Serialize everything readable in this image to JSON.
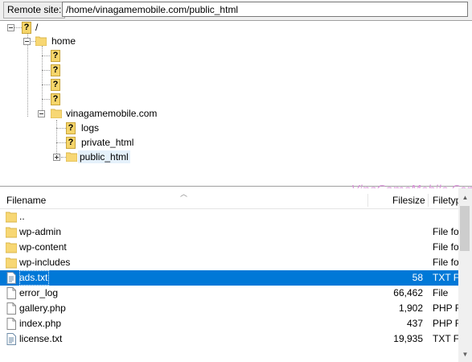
{
  "site_bar": {
    "label": "Remote site:",
    "path": "/home/vinagamemobile.com/public_html"
  },
  "tree": {
    "root": "/",
    "home": "home",
    "unknown_1": "?",
    "unknown_2": "?",
    "unknown_3": "?",
    "unknown_4": "?",
    "domain": "vinagamemobile.com",
    "children": [
      {
        "label": "logs",
        "icon": "unknown-icon"
      },
      {
        "label": "private_html",
        "icon": "unknown-icon"
      },
      {
        "label": "public_html",
        "icon": "folder-icon"
      }
    ]
  },
  "watermark": "VinaGameMobile.Com",
  "file_list": {
    "columns": [
      "Filename",
      "Filesize",
      "Filetype"
    ],
    "rows": [
      {
        "name": "..",
        "size": "",
        "type": "",
        "icon": "folder-icon"
      },
      {
        "name": "wp-admin",
        "size": "",
        "type": "File folder",
        "icon": "folder-icon"
      },
      {
        "name": "wp-content",
        "size": "",
        "type": "File folder",
        "icon": "folder-icon"
      },
      {
        "name": "wp-includes",
        "size": "",
        "type": "File folder",
        "icon": "folder-icon"
      },
      {
        "name": "ads.txt",
        "size": "58",
        "type": "TXT File",
        "icon": "text-file-icon",
        "selected": true
      },
      {
        "name": "error_log",
        "size": "66,462",
        "type": "File",
        "icon": "file-icon"
      },
      {
        "name": "gallery.php",
        "size": "1,902",
        "type": "PHP File",
        "icon": "file-icon"
      },
      {
        "name": "index.php",
        "size": "437",
        "type": "PHP File",
        "icon": "file-icon"
      },
      {
        "name": "license.txt",
        "size": "19,935",
        "type": "TXT File",
        "icon": "text-file-icon"
      }
    ]
  },
  "colors": {
    "selection": "#0078d7",
    "folder": "#f7d774",
    "unknown_badge": "#f5d56a"
  }
}
